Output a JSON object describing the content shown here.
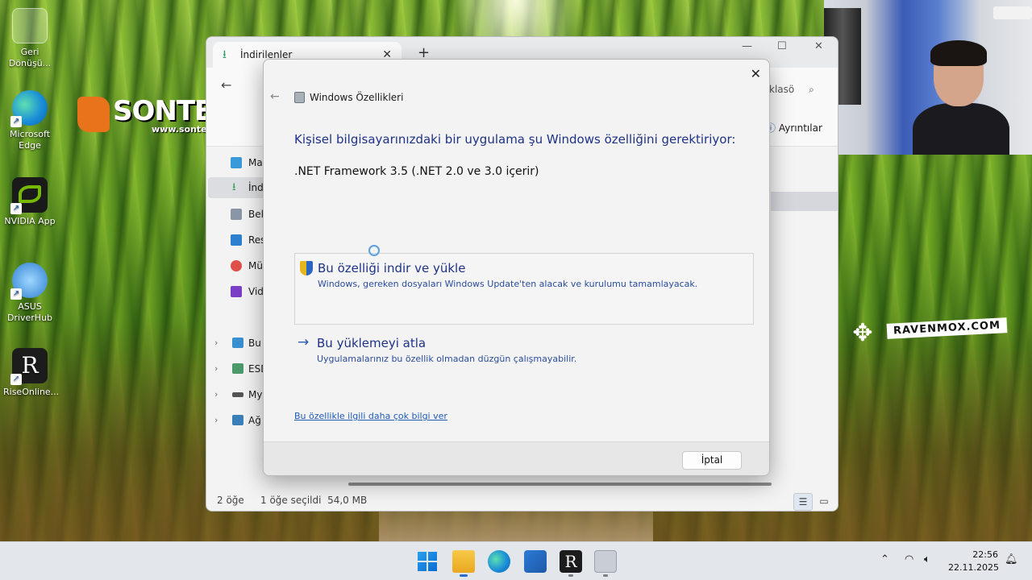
{
  "desktop": {
    "icons": [
      {
        "label": "Geri Dönüşü...",
        "icon": "recycle-bin-icon"
      },
      {
        "label": "Microsoft Edge",
        "icon": "edge-icon"
      },
      {
        "label": "NVIDIA App",
        "icon": "nvidia-icon"
      },
      {
        "label": "ASUS DriverHub",
        "icon": "asus-driverhub-icon"
      },
      {
        "label": "RiseOnline...",
        "icon": "riseonline-icon"
      }
    ],
    "watermark_brand": "SONTEKLIF",
    "watermark_site": "www.sonteklif.com",
    "watermark2": "RAVENMOX.COM"
  },
  "explorer": {
    "tab_title": "İndirilenler",
    "search_fragment": "klasö",
    "details_label": "Ayrıntılar",
    "sidebar": [
      "Mas",
      "İndi",
      "Belg",
      "Resi",
      "Müz",
      "Vide"
    ],
    "tree": [
      "Bu b",
      "ESD",
      "My",
      "Ağ"
    ],
    "status_count": "2 öğe",
    "status_selected": "1 öğe seçildi  54,0 MB"
  },
  "dialog": {
    "title": "Windows Özellikleri",
    "heading": "Kişisel bilgisayarınızdaki bir uygulama şu Windows özelliğini gerektiriyor:",
    "feature": ".NET Framework 3.5 (.NET 2.0 ve 3.0 içerir)",
    "option1_title": "Bu özelliği indir ve yükle",
    "option1_desc": "Windows, gereken dosyaları Windows Update'ten alacak ve kurulumu tamamlayacak.",
    "option2_title": "Bu yüklemeyi atla",
    "option2_desc": "Uygulamalarınız bu özellik olmadan düzgün çalışmayabilir.",
    "link": "Bu özellikle ilgili daha çok bilgi ver",
    "cancel": "İptal"
  },
  "taskbar": {
    "time": "22:56",
    "date": "22.11.2025"
  },
  "colors": {
    "dialog_heading": "#1e3287",
    "link": "#1e5bb5",
    "taskbar_bg": "#e3e6ea"
  }
}
